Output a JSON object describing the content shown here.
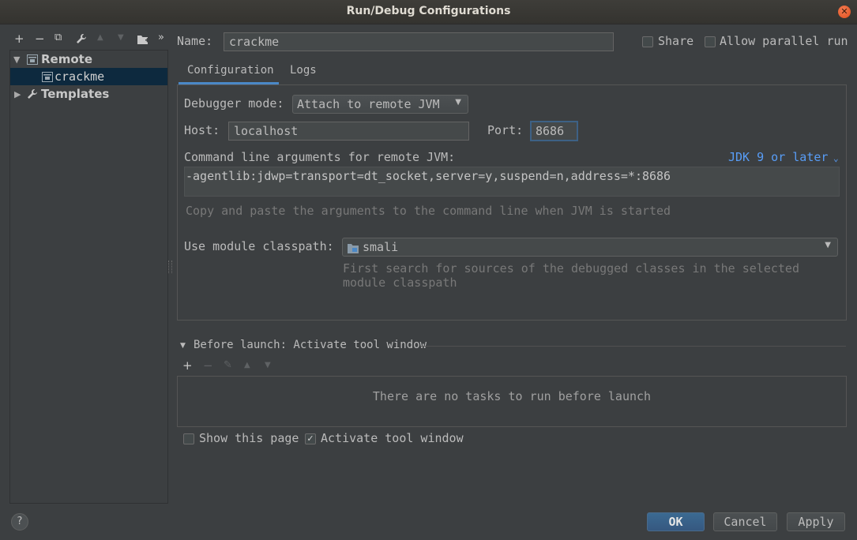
{
  "window": {
    "title": "Run/Debug Configurations",
    "close_icon": "close-icon"
  },
  "toolbar": {
    "add": "+",
    "remove": "−",
    "copy": "⧉",
    "wrench": "🔧",
    "up": "▲",
    "down": "▼",
    "folder": "▰",
    "more": "»"
  },
  "tree": {
    "group": "Remote",
    "item": "crackme",
    "templates": "Templates"
  },
  "header": {
    "name_label": "Name:",
    "name_value": "crackme",
    "share_label": "Share",
    "parallel_label": "Allow parallel run"
  },
  "tabs": [
    "Configuration",
    "Logs"
  ],
  "config": {
    "debugger_mode_label": "Debugger mode:",
    "debugger_mode_value": "Attach to remote JVM",
    "host_label": "Host:",
    "host_value": "localhost",
    "port_label": "Port:",
    "port_value": "8686",
    "cmd_label": "Command line arguments for remote JVM:",
    "jdk_link": "JDK 9 or later",
    "cmd_value": "-agentlib:jdwp=transport=dt_socket,server=y,suspend=n,address=*:8686",
    "cmd_hint": "Copy and paste the arguments to the command line when JVM is started",
    "module_label": "Use module classpath:",
    "module_value": "smali",
    "module_hint_line1": "First search for sources of the debugged classes in the selected",
    "module_hint_line2": "module classpath"
  },
  "before_launch": {
    "title": "Before launch: Activate tool window",
    "empty_text": "There are no tasks to run before launch",
    "tools": {
      "add": "+",
      "remove": "−",
      "edit": "✎",
      "up": "▲",
      "down": "▼"
    }
  },
  "footer": {
    "show_page_label": "Show this page",
    "activate_label": "Activate tool window",
    "help": "?",
    "ok": "OK",
    "cancel": "Cancel",
    "apply": "Apply"
  },
  "colors": {
    "accent": "#589df6",
    "selection": "#0d293e",
    "primary_button": "#365880"
  }
}
